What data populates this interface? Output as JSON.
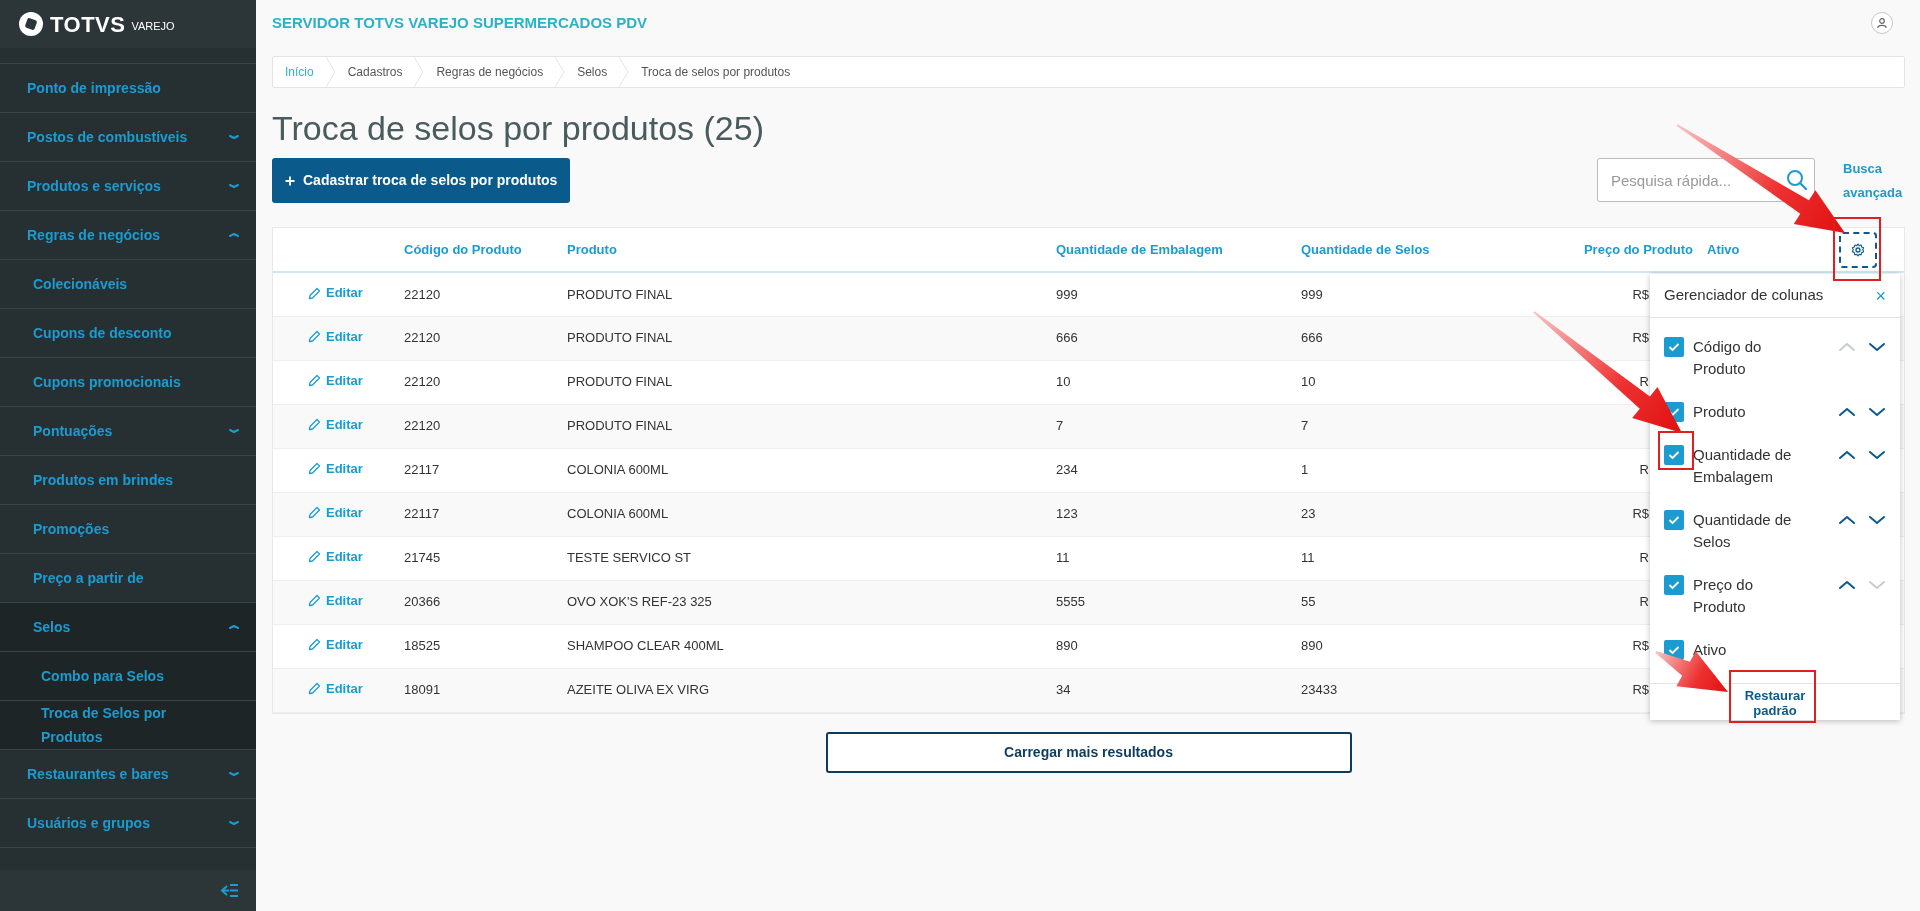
{
  "sidebar": {
    "logo": {
      "name": "TOTVS",
      "tag": "VAREJO"
    },
    "items": [
      {
        "label": "Ponto de impressão"
      },
      {
        "label": "Postos de combustíveis",
        "expanded": false
      },
      {
        "label": "Produtos e serviços",
        "expanded": false
      },
      {
        "label": "Regras de negócios",
        "expanded": true,
        "children": [
          {
            "label": "Colecionáveis"
          },
          {
            "label": "Cupons de desconto"
          },
          {
            "label": "Cupons promocionais"
          },
          {
            "label": "Pontuações",
            "expanded": false
          },
          {
            "label": "Produtos em brindes"
          },
          {
            "label": "Promoções"
          },
          {
            "label": "Preço a partir de"
          },
          {
            "label": "Selos",
            "expanded": true,
            "children": [
              {
                "label": "Combo para Selos"
              },
              {
                "label": "Troca de Selos por Produtos"
              }
            ]
          }
        ]
      },
      {
        "label": "Restaurantes e bares",
        "expanded": false
      },
      {
        "label": "Usuários e grupos",
        "expanded": false
      }
    ]
  },
  "header": {
    "server": "SERVIDOR TOTVS VAREJO SUPERMERCADOS PDV"
  },
  "breadcrumb": [
    {
      "label": "Início",
      "link": true
    },
    {
      "label": "Cadastros",
      "link": false
    },
    {
      "label": "Regras de negócios",
      "link": false
    },
    {
      "label": "Selos",
      "link": false
    },
    {
      "label": "Troca de selos por produtos",
      "link": false
    }
  ],
  "page_title": "Troca de selos por produtos (25)",
  "primary_button": "Cadastrar troca de selos por produtos",
  "search": {
    "placeholder": "Pesquisa rápida..."
  },
  "advanced_search": "Busca avançada",
  "table": {
    "columns": [
      "Código do Produto",
      "Produto",
      "Quantidade de Embalagem",
      "Quantidade de Selos",
      "Preço do Produto",
      "Ativo"
    ],
    "rows": [
      {
        "action": "Editar",
        "cells": [
          "22120",
          "PRODUTO FINAL",
          "999",
          "999",
          "R$"
        ]
      },
      {
        "action": "Editar",
        "cells": [
          "22120",
          "PRODUTO FINAL",
          "666",
          "666",
          "R$"
        ]
      },
      {
        "action": "Editar",
        "cells": [
          "22120",
          "PRODUTO FINAL",
          "10",
          "10",
          "R"
        ]
      },
      {
        "action": "Editar",
        "cells": [
          "22120",
          "PRODUTO FINAL",
          "7",
          "7"
        ]
      },
      {
        "action": "Editar",
        "cells": [
          "22117",
          "COLONIA 600ML",
          "234",
          "1",
          "R"
        ]
      },
      {
        "action": "Editar",
        "cells": [
          "22117",
          "COLONIA 600ML",
          "123",
          "23",
          "R$"
        ]
      },
      {
        "action": "Editar",
        "cells": [
          "21745",
          "TESTE SERVICO ST",
          "11",
          "11",
          "R"
        ]
      },
      {
        "action": "Editar",
        "cells": [
          "20366",
          "OVO XOK'S REF-23 325",
          "5555",
          "55",
          "R"
        ]
      },
      {
        "action": "Editar",
        "cells": [
          "18525",
          "SHAMPOO CLEAR 400ML",
          "890",
          "890",
          "R$"
        ]
      },
      {
        "action": "Editar",
        "cells": [
          "18091",
          "AZEITE OLIVA EX VIRG",
          "34",
          "23433",
          "R$"
        ]
      }
    ]
  },
  "column_manager": {
    "title": "Gerenciador de colunas",
    "close": "×",
    "items": [
      {
        "label": "Código do Produto",
        "checked": true,
        "up_enabled": false,
        "down_enabled": true
      },
      {
        "label": "Produto",
        "checked": true,
        "up_enabled": true,
        "down_enabled": true
      },
      {
        "label": "Quantidade de Embalagem",
        "checked": true,
        "up_enabled": true,
        "down_enabled": true
      },
      {
        "label": "Quantidade de Selos",
        "checked": true,
        "up_enabled": true,
        "down_enabled": true
      },
      {
        "label": "Preço do Produto",
        "checked": true,
        "up_enabled": true,
        "down_enabled": false
      },
      {
        "label": "Ativo",
        "checked": true
      }
    ],
    "reset_button": "Restaurar padrão"
  },
  "load_more": "Carregar mais resultados"
}
